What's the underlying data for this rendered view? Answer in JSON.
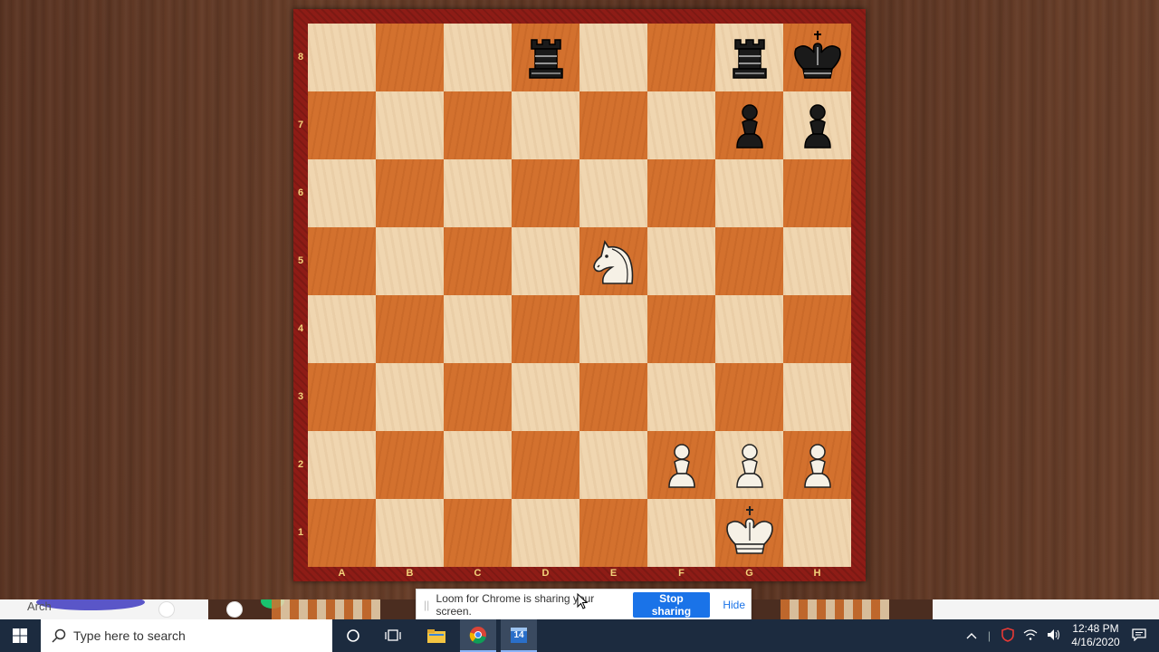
{
  "board": {
    "ranks": [
      "8",
      "7",
      "6",
      "5",
      "4",
      "3",
      "2",
      "1"
    ],
    "files": [
      "A",
      "B",
      "C",
      "D",
      "E",
      "F",
      "G",
      "H"
    ],
    "pieces": [
      {
        "square": "d8",
        "color": "black",
        "type": "rook"
      },
      {
        "square": "g8",
        "color": "black",
        "type": "rook"
      },
      {
        "square": "h8",
        "color": "black",
        "type": "king"
      },
      {
        "square": "g7",
        "color": "black",
        "type": "pawn"
      },
      {
        "square": "h7",
        "color": "black",
        "type": "pawn"
      },
      {
        "square": "e5",
        "color": "white",
        "type": "knight"
      },
      {
        "square": "f2",
        "color": "white",
        "type": "pawn"
      },
      {
        "square": "g2",
        "color": "white",
        "type": "pawn"
      },
      {
        "square": "h2",
        "color": "white",
        "type": "pawn"
      },
      {
        "square": "g1",
        "color": "white",
        "type": "king"
      }
    ],
    "colors": {
      "light": "#f0d6b0",
      "dark": "#d3712e",
      "frame": "#8e1c16",
      "label": "#f3d27a"
    }
  },
  "underlay": {
    "partial_text": "Arch"
  },
  "share_bar": {
    "message": "Loom for Chrome is sharing your screen.",
    "stop_label": "Stop sharing",
    "hide_label": "Hide",
    "grip_icon": "drag-handle-icon"
  },
  "taskbar": {
    "search_placeholder": "Type here to search",
    "icons": [
      "windows-start-icon",
      "search-icon",
      "cortana-icon",
      "task-view-icon",
      "file-explorer-icon",
      "chrome-icon",
      "calendar-app-icon"
    ],
    "calendar_day": "14",
    "tray_icons": [
      "chevron-up-icon",
      "security-shield-icon",
      "wifi-icon",
      "volume-icon",
      "notification-icon"
    ],
    "time": "12:48 PM",
    "date": "4/16/2020"
  }
}
